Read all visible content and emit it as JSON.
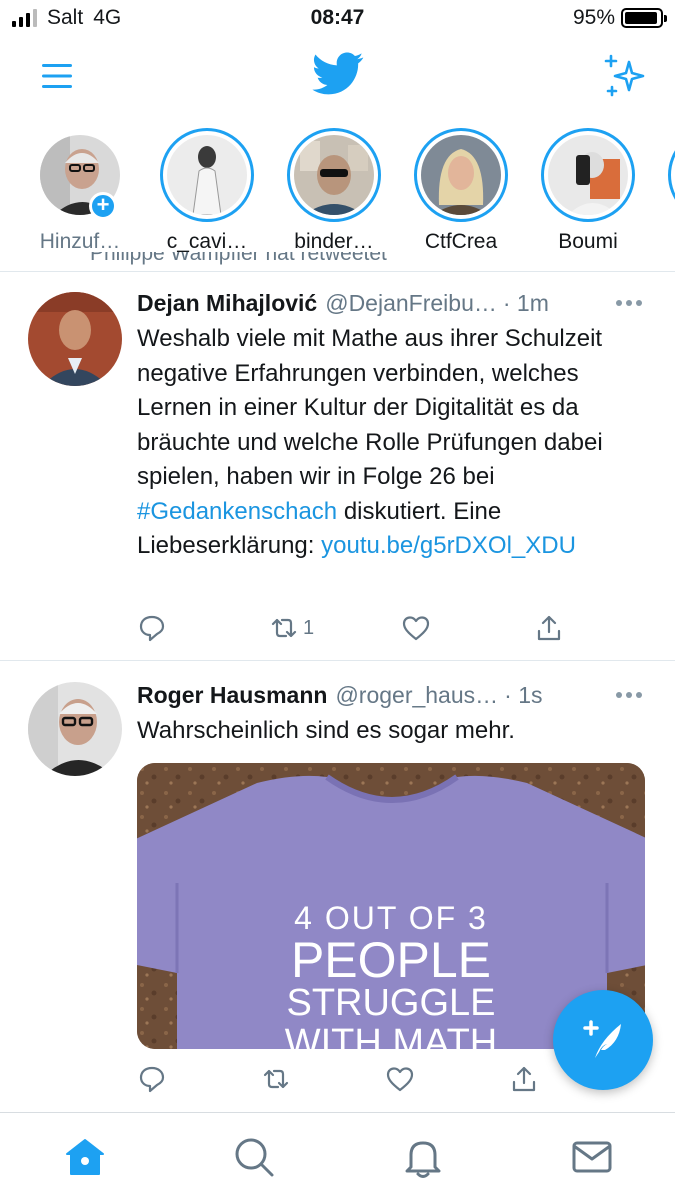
{
  "status_bar": {
    "carrier": "Salt",
    "network": "4G",
    "time": "08:47",
    "battery": "95%",
    "battery_level": 0.95
  },
  "nav": {
    "menu_icon": "hamburger-menu-icon",
    "logo_icon": "twitter-bird-icon",
    "sparkle_icon": "sparkle-icon",
    "brand_color": "#1da1f2"
  },
  "stories": [
    {
      "label": "Hinzuf…",
      "own": true
    },
    {
      "label": "c_cavi…"
    },
    {
      "label": "binder…"
    },
    {
      "label": "CtfCrea"
    },
    {
      "label": "Boumi"
    }
  ],
  "retweet_header": "Philippe Wampfler hat retweetet",
  "tweets": [
    {
      "name": "Dejan Mihajlović",
      "handle": "@DejanFreibu…",
      "time": "· 1m",
      "text_parts": {
        "before": "Weshalb viele mit Mathe aus ihrer Schulzeit negative Erfahrungen verbinden, welches Lernen in einer Kultur der Digitalität es da bräuchte und welche Rolle Prüfungen dabei spielen, haben wir in Folge 26 bei ",
        "hashtag": "#Gedankenschach",
        "middle": " diskutiert. Eine Liebeserklärung: ",
        "link": "youtu.be/g5rDXOl_XDU"
      },
      "retweet_count": "1"
    },
    {
      "name": "Roger Hausmann",
      "handle": "@roger_haus…",
      "time": "· 1s",
      "text": "Wahrscheinlich sind es sogar mehr.",
      "image_text": {
        "line1": "4 OUT OF 3",
        "line2": "PEOPLE",
        "line3": "STRUGGLE",
        "line4": "WITH MATH"
      }
    }
  ],
  "tabs": [
    "home-icon",
    "search-icon",
    "notifications-icon",
    "messages-icon"
  ]
}
